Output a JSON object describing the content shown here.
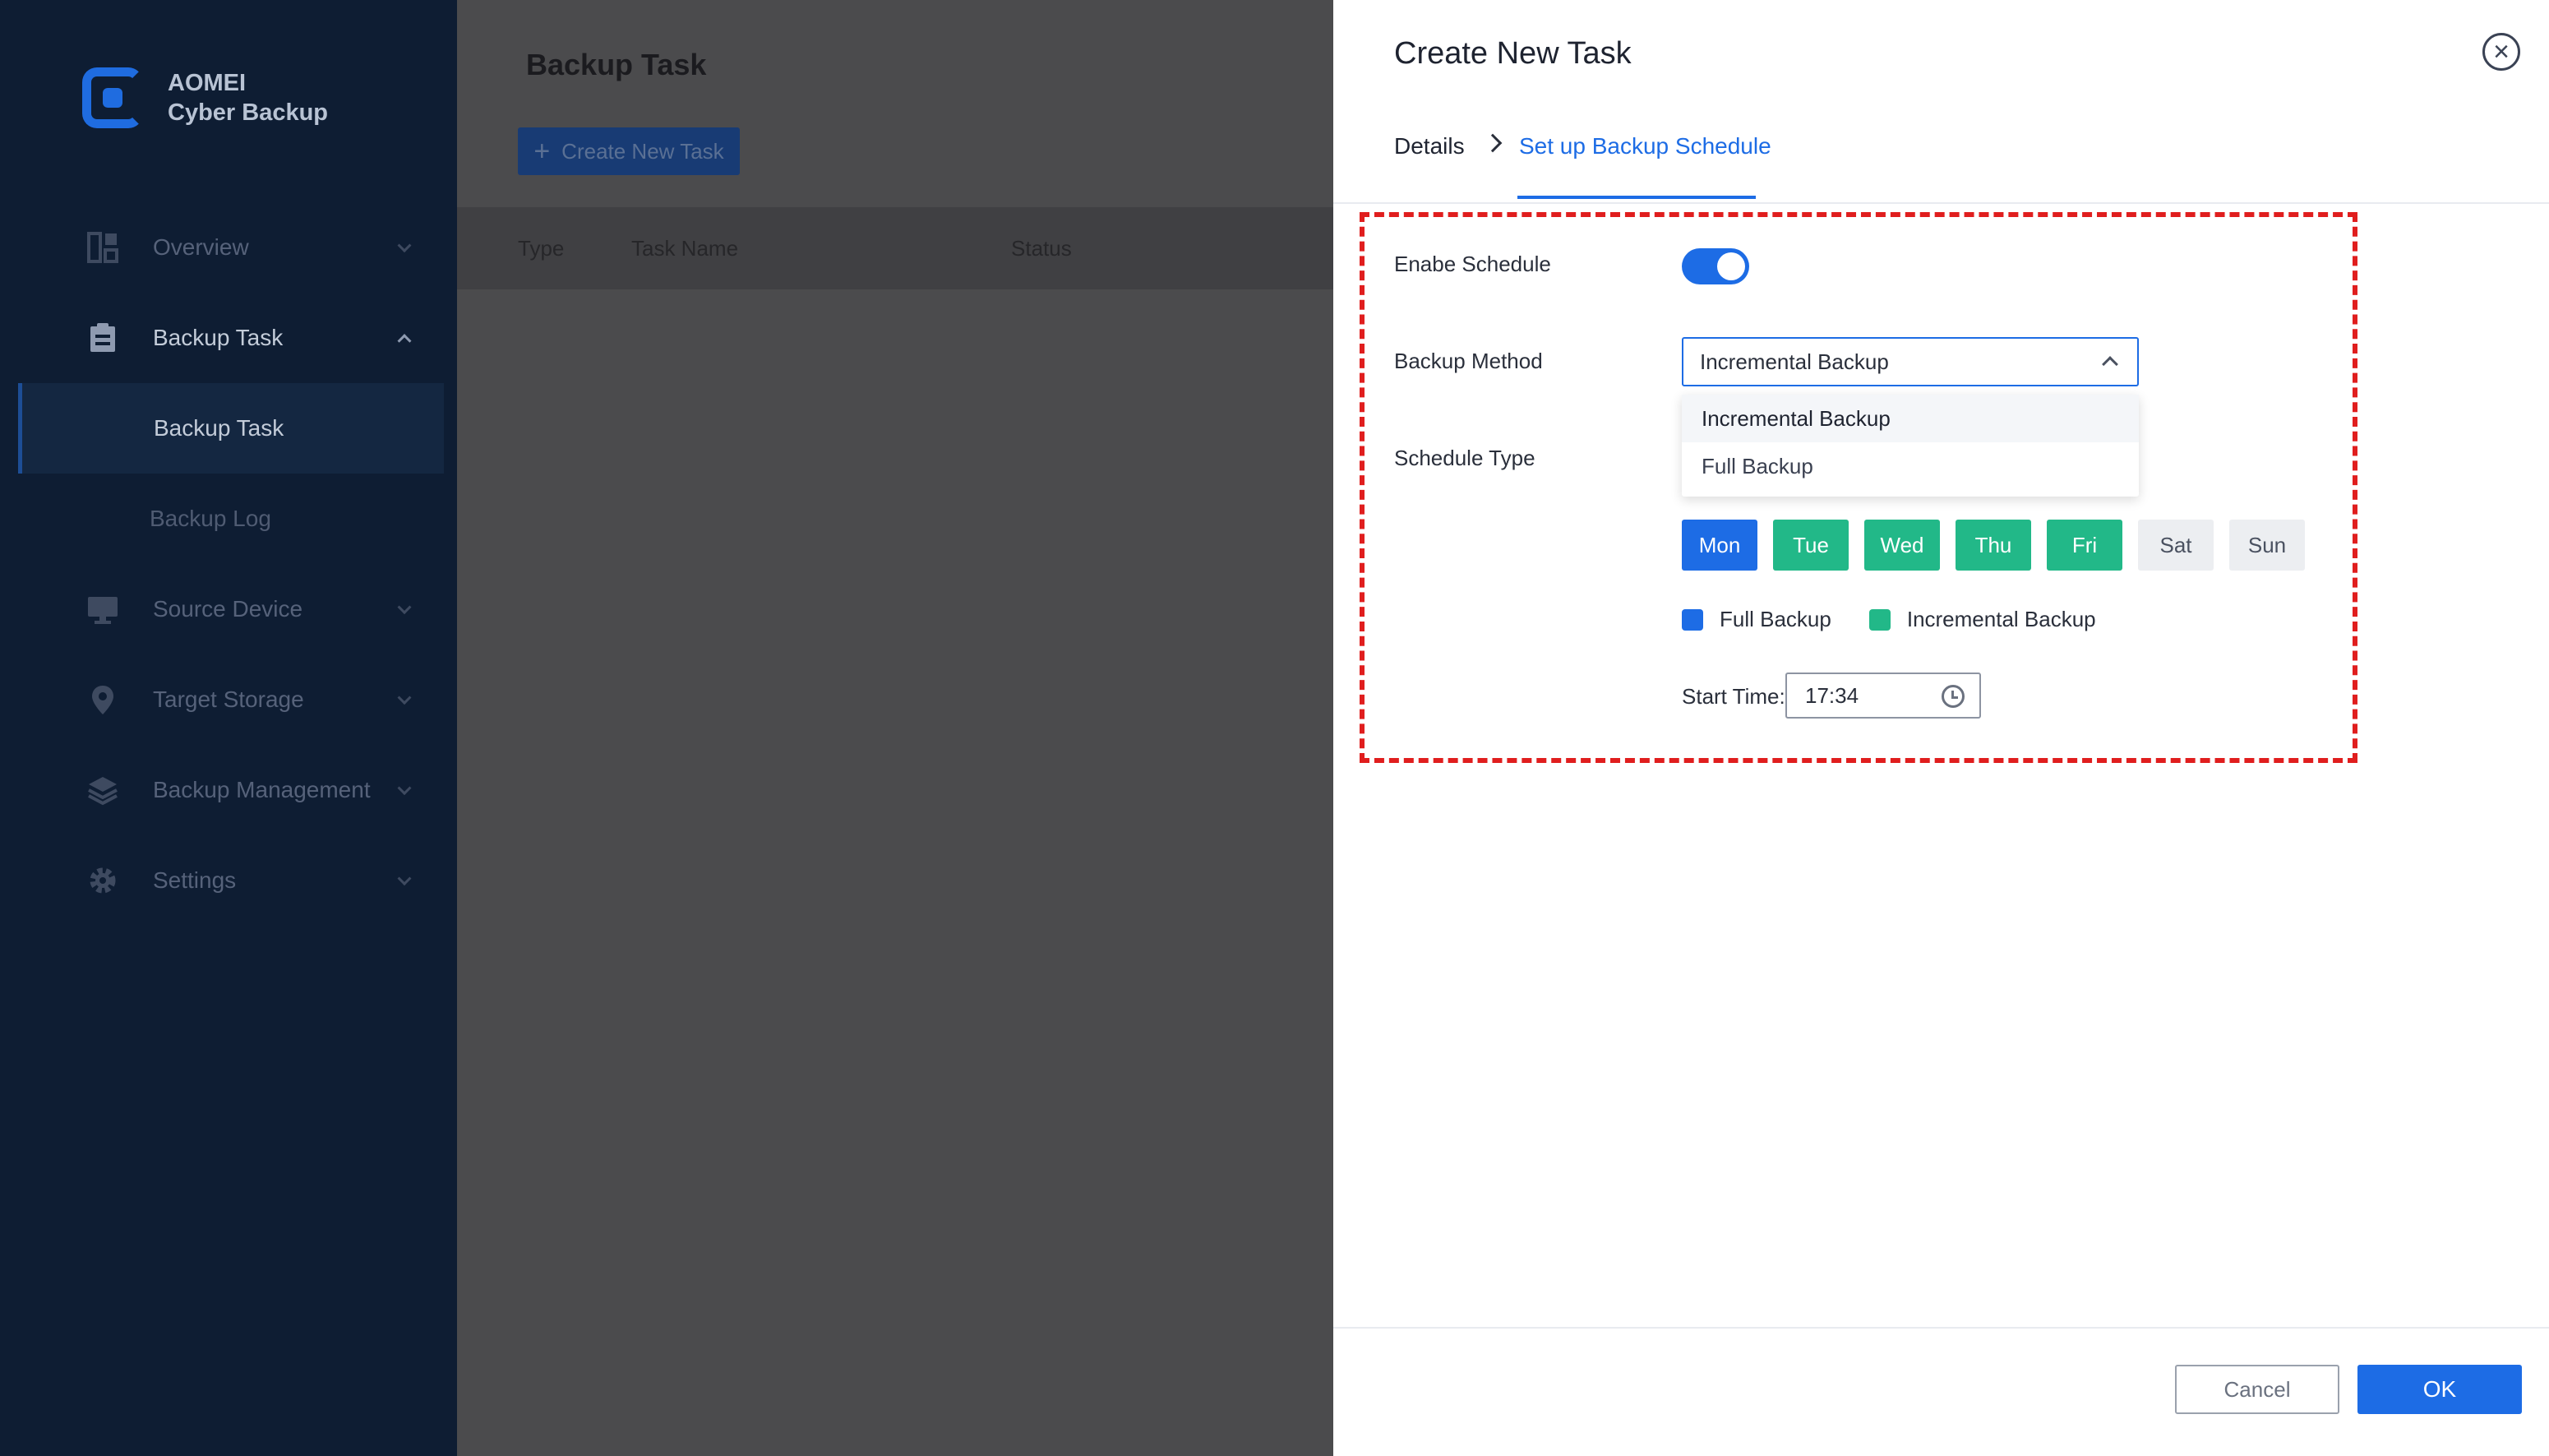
{
  "app": {
    "name_line1": "AOMEI",
    "name_line2": "Cyber Backup"
  },
  "sidebar": {
    "items": [
      {
        "label": "Overview"
      },
      {
        "label": "Backup Task"
      },
      {
        "label": "Source Device"
      },
      {
        "label": "Target Storage"
      },
      {
        "label": "Backup Management"
      },
      {
        "label": "Settings"
      }
    ],
    "sub_items": [
      {
        "label": "Backup Task"
      },
      {
        "label": "Backup Log"
      }
    ]
  },
  "main": {
    "title": "Backup Task",
    "create_label": "Create New Task",
    "create_icon": "+",
    "columns": [
      "Type",
      "Task Name",
      "Status"
    ]
  },
  "panel": {
    "title": "Create New Task",
    "close_icon": "×",
    "tabs": {
      "details": "Details",
      "active": "Set up Backup Schedule"
    },
    "enable_label": "Enabe Schedule",
    "method_label": "Backup Method",
    "method_value": "Incremental Backup",
    "method_options": [
      "Incremental Backup",
      "Full Backup"
    ],
    "schedule_type_label": "Schedule Type",
    "days": [
      {
        "label": "Mon",
        "state": "full"
      },
      {
        "label": "Tue",
        "state": "inc"
      },
      {
        "label": "Wed",
        "state": "inc"
      },
      {
        "label": "Thu",
        "state": "inc"
      },
      {
        "label": "Fri",
        "state": "inc"
      },
      {
        "label": "Sat",
        "state": "off"
      },
      {
        "label": "Sun",
        "state": "off"
      }
    ],
    "legend": {
      "full": "Full Backup",
      "incremental": "Incremental Backup"
    },
    "start_time_label": "Start Time:",
    "start_time_value": "17:34",
    "cancel_label": "Cancel",
    "ok_label": "OK"
  },
  "colors": {
    "accent": "#1d6ce5",
    "incremental": "#22b888",
    "highlight": "#e01e1e",
    "sidebar_bg": "#0e1d33"
  }
}
